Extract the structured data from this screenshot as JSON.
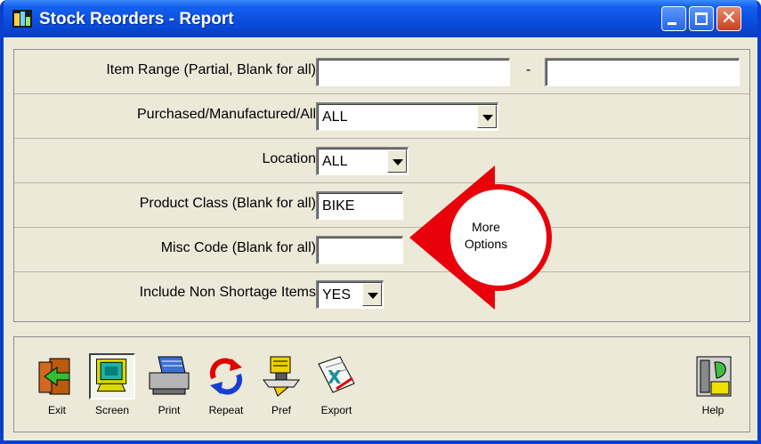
{
  "window": {
    "title": "Stock Reorders - Report",
    "title_bar_color": "#0a4fe0",
    "controls": [
      "minimize-icon",
      "maximize-icon",
      "close-icon"
    ]
  },
  "form": {
    "item_range": {
      "label": "Item Range (Partial, Blank for all)",
      "from_value": "",
      "separator": "-",
      "to_value": ""
    },
    "purchased": {
      "label": "Purchased/Manufactured/All",
      "value": "ALL"
    },
    "location": {
      "label": "Location",
      "value": "ALL"
    },
    "product_class": {
      "label": "Product Class (Blank for all)",
      "value": "BIKE"
    },
    "misc_code": {
      "label": "Misc Code (Blank for all)",
      "value": ""
    },
    "non_shortage": {
      "label": "Include Non Shortage Items",
      "value": "YES"
    }
  },
  "more_options": {
    "line1": "More",
    "line2": "Options",
    "color": "#e8000a"
  },
  "toolbar": {
    "exit": "Exit",
    "screen": "Screen",
    "print": "Print",
    "repeat": "Repeat",
    "pref": "Pref",
    "export": "Export",
    "help": "Help"
  }
}
